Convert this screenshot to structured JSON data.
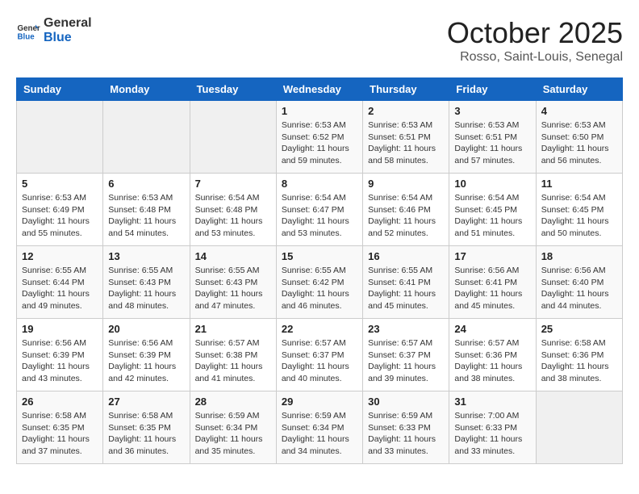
{
  "header": {
    "logo_line1": "General",
    "logo_line2": "Blue",
    "month": "October 2025",
    "location": "Rosso, Saint-Louis, Senegal"
  },
  "weekdays": [
    "Sunday",
    "Monday",
    "Tuesday",
    "Wednesday",
    "Thursday",
    "Friday",
    "Saturday"
  ],
  "weeks": [
    [
      {
        "day": "",
        "info": ""
      },
      {
        "day": "",
        "info": ""
      },
      {
        "day": "",
        "info": ""
      },
      {
        "day": "1",
        "info": "Sunrise: 6:53 AM\nSunset: 6:52 PM\nDaylight: 11 hours and 59 minutes."
      },
      {
        "day": "2",
        "info": "Sunrise: 6:53 AM\nSunset: 6:51 PM\nDaylight: 11 hours and 58 minutes."
      },
      {
        "day": "3",
        "info": "Sunrise: 6:53 AM\nSunset: 6:51 PM\nDaylight: 11 hours and 57 minutes."
      },
      {
        "day": "4",
        "info": "Sunrise: 6:53 AM\nSunset: 6:50 PM\nDaylight: 11 hours and 56 minutes."
      }
    ],
    [
      {
        "day": "5",
        "info": "Sunrise: 6:53 AM\nSunset: 6:49 PM\nDaylight: 11 hours and 55 minutes."
      },
      {
        "day": "6",
        "info": "Sunrise: 6:53 AM\nSunset: 6:48 PM\nDaylight: 11 hours and 54 minutes."
      },
      {
        "day": "7",
        "info": "Sunrise: 6:54 AM\nSunset: 6:48 PM\nDaylight: 11 hours and 53 minutes."
      },
      {
        "day": "8",
        "info": "Sunrise: 6:54 AM\nSunset: 6:47 PM\nDaylight: 11 hours and 53 minutes."
      },
      {
        "day": "9",
        "info": "Sunrise: 6:54 AM\nSunset: 6:46 PM\nDaylight: 11 hours and 52 minutes."
      },
      {
        "day": "10",
        "info": "Sunrise: 6:54 AM\nSunset: 6:45 PM\nDaylight: 11 hours and 51 minutes."
      },
      {
        "day": "11",
        "info": "Sunrise: 6:54 AM\nSunset: 6:45 PM\nDaylight: 11 hours and 50 minutes."
      }
    ],
    [
      {
        "day": "12",
        "info": "Sunrise: 6:55 AM\nSunset: 6:44 PM\nDaylight: 11 hours and 49 minutes."
      },
      {
        "day": "13",
        "info": "Sunrise: 6:55 AM\nSunset: 6:43 PM\nDaylight: 11 hours and 48 minutes."
      },
      {
        "day": "14",
        "info": "Sunrise: 6:55 AM\nSunset: 6:43 PM\nDaylight: 11 hours and 47 minutes."
      },
      {
        "day": "15",
        "info": "Sunrise: 6:55 AM\nSunset: 6:42 PM\nDaylight: 11 hours and 46 minutes."
      },
      {
        "day": "16",
        "info": "Sunrise: 6:55 AM\nSunset: 6:41 PM\nDaylight: 11 hours and 45 minutes."
      },
      {
        "day": "17",
        "info": "Sunrise: 6:56 AM\nSunset: 6:41 PM\nDaylight: 11 hours and 45 minutes."
      },
      {
        "day": "18",
        "info": "Sunrise: 6:56 AM\nSunset: 6:40 PM\nDaylight: 11 hours and 44 minutes."
      }
    ],
    [
      {
        "day": "19",
        "info": "Sunrise: 6:56 AM\nSunset: 6:39 PM\nDaylight: 11 hours and 43 minutes."
      },
      {
        "day": "20",
        "info": "Sunrise: 6:56 AM\nSunset: 6:39 PM\nDaylight: 11 hours and 42 minutes."
      },
      {
        "day": "21",
        "info": "Sunrise: 6:57 AM\nSunset: 6:38 PM\nDaylight: 11 hours and 41 minutes."
      },
      {
        "day": "22",
        "info": "Sunrise: 6:57 AM\nSunset: 6:37 PM\nDaylight: 11 hours and 40 minutes."
      },
      {
        "day": "23",
        "info": "Sunrise: 6:57 AM\nSunset: 6:37 PM\nDaylight: 11 hours and 39 minutes."
      },
      {
        "day": "24",
        "info": "Sunrise: 6:57 AM\nSunset: 6:36 PM\nDaylight: 11 hours and 38 minutes."
      },
      {
        "day": "25",
        "info": "Sunrise: 6:58 AM\nSunset: 6:36 PM\nDaylight: 11 hours and 38 minutes."
      }
    ],
    [
      {
        "day": "26",
        "info": "Sunrise: 6:58 AM\nSunset: 6:35 PM\nDaylight: 11 hours and 37 minutes."
      },
      {
        "day": "27",
        "info": "Sunrise: 6:58 AM\nSunset: 6:35 PM\nDaylight: 11 hours and 36 minutes."
      },
      {
        "day": "28",
        "info": "Sunrise: 6:59 AM\nSunset: 6:34 PM\nDaylight: 11 hours and 35 minutes."
      },
      {
        "day": "29",
        "info": "Sunrise: 6:59 AM\nSunset: 6:34 PM\nDaylight: 11 hours and 34 minutes."
      },
      {
        "day": "30",
        "info": "Sunrise: 6:59 AM\nSunset: 6:33 PM\nDaylight: 11 hours and 33 minutes."
      },
      {
        "day": "31",
        "info": "Sunrise: 7:00 AM\nSunset: 6:33 PM\nDaylight: 11 hours and 33 minutes."
      },
      {
        "day": "",
        "info": ""
      }
    ]
  ]
}
